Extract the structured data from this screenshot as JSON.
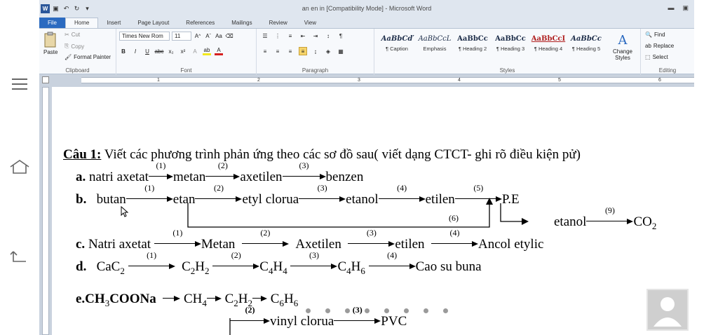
{
  "window": {
    "title": "an en in [Compatibility Mode] - Microsoft Word"
  },
  "tabs": [
    "File",
    "Home",
    "Insert",
    "Page Layout",
    "References",
    "Mailings",
    "Review",
    "View"
  ],
  "clipboard": {
    "paste": "Paste",
    "cut": "Cut",
    "copy": "Copy",
    "format_painter": "Format Painter",
    "label": "Clipboard"
  },
  "font": {
    "name": "Times New Rom",
    "size": "11",
    "label": "Font"
  },
  "paragraph": {
    "label": "Paragraph"
  },
  "styles": {
    "label": "Styles",
    "items": [
      {
        "sample": "AaBbCď",
        "name": "¶ Caption"
      },
      {
        "sample": "AaBbCcL",
        "name": "Emphasis"
      },
      {
        "sample": "AaBbCc",
        "name": "¶ Heading 2"
      },
      {
        "sample": "AaBbCc",
        "name": "¶ Heading 3"
      },
      {
        "sample": "AaBbCcI",
        "name": "¶ Heading 4"
      },
      {
        "sample": "AaBbCc",
        "name": "¶ Heading 5"
      }
    ],
    "change_styles": "Change Styles"
  },
  "editing": {
    "label": "Editing",
    "find": "Find",
    "replace": "Replace",
    "select": "Select"
  },
  "ruler_numbers": [
    "1",
    "2",
    "3",
    "4",
    "5",
    "6"
  ],
  "doc": {
    "heading_label": "Câu 1:",
    "heading_text": " Viết các phương trình phản ứng theo các sơ đồ sau( viết dạng CTCT- ghi rõ điều kiện pử)",
    "a": {
      "letter": "a.",
      "s0": "natri axetat",
      "s1": "metan",
      "s2": "axetilen",
      "s3": "benzen"
    },
    "b": {
      "letter": "b.",
      "s0": "butan",
      "s1": "etan",
      "s2": "etyl clorua",
      "s3": "etanol",
      "s4": "etilen",
      "s5": "P.E",
      "s6": "etanol",
      "s7": "CO"
    },
    "c": {
      "letter": "c.",
      "s0": "Natri axetat",
      "s1": "Metan",
      "s2": "Axetilen",
      "s3": "etilen",
      "s4": "Ancol etylic"
    },
    "d": {
      "letter": "d.",
      "s4": "Cao su buna"
    },
    "e": {
      "prefix": "e.CH",
      "suffix": "COONa"
    },
    "f": {
      "s1": "vinyl clorua",
      "s2": "PVC"
    },
    "labels": {
      "n1": "(1)",
      "n2": "(2)",
      "n3": "(3)",
      "n4": "(4)",
      "n5": "(5)",
      "n6": "(6)",
      "n9": "(9)"
    }
  }
}
